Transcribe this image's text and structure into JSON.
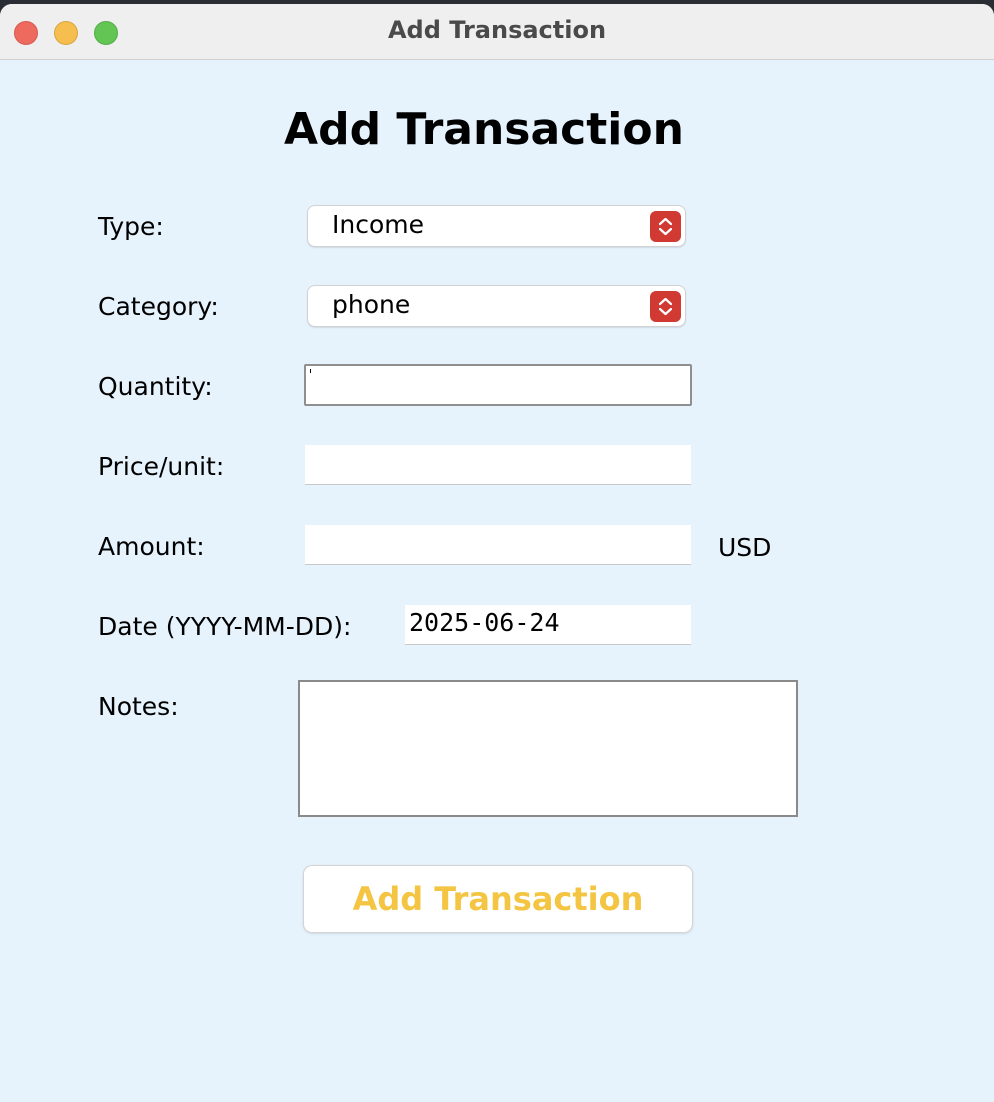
{
  "window": {
    "title": "Add Transaction"
  },
  "form": {
    "heading": "Add Transaction",
    "type": {
      "label": "Type:",
      "selected": "Income"
    },
    "category": {
      "label": "Category:",
      "selected": "phone"
    },
    "quantity": {
      "label": "Quantity:",
      "value": ""
    },
    "price_per_unit": {
      "label": "Price/unit:",
      "value": ""
    },
    "amount": {
      "label": "Amount:",
      "value": "",
      "unit": "USD"
    },
    "date": {
      "label": "Date (YYYY-MM-DD):",
      "value": "2025-06-24"
    },
    "notes": {
      "label": "Notes:",
      "value": ""
    },
    "submit_label": "Add Transaction"
  },
  "colors": {
    "background": "#e6f3fd",
    "combo_accent": "#d03a33",
    "submit_text": "#f4c542"
  },
  "icons": {
    "close": "close-traffic-light",
    "minimize": "minimize-traffic-light",
    "zoom": "zoom-traffic-light",
    "combo": "updown-chevron-icon"
  }
}
